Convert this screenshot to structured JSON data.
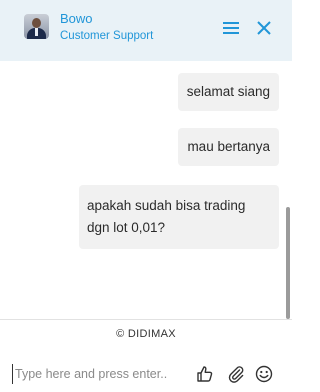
{
  "header": {
    "agent_name": "Bowo",
    "agent_role": "Customer Support",
    "accent_color": "#2196d8",
    "background_color": "#e9f2f7"
  },
  "messages": [
    {
      "text": "selamat siang",
      "side": "right"
    },
    {
      "text": "mau bertanya",
      "side": "right"
    },
    {
      "text": "apakah sudah bisa trading dgn lot 0,01?",
      "side": "right"
    }
  ],
  "footer": {
    "brand": "© DIDIMAX",
    "input_placeholder": "Type here and press enter..",
    "icons": [
      "thumbs-up-icon",
      "paperclip-icon",
      "emoji-icon"
    ]
  }
}
